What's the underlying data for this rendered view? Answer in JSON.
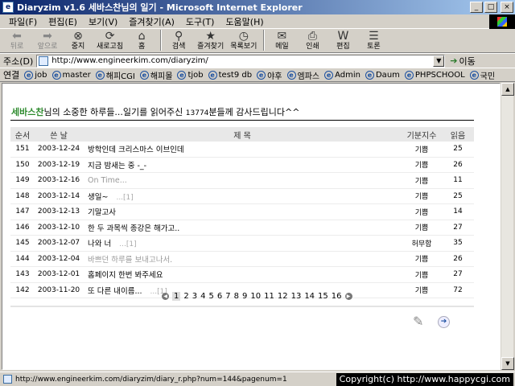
{
  "window": {
    "title": "Diaryzim v1.6 세바스찬님의 일기 - Microsoft Internet Explorer",
    "min_glyph": "_",
    "max_glyph": "□",
    "close_glyph": "×"
  },
  "menu": [
    "파일(F)",
    "편집(E)",
    "보기(V)",
    "즐겨찾기(A)",
    "도구(T)",
    "도움말(H)"
  ],
  "toolbar": {
    "back": "뒤로",
    "forward": "앞으로",
    "stop": "중지",
    "refresh": "새로고침",
    "home": "홈",
    "search": "검색",
    "favorites": "즐겨찾기",
    "history": "목록보기",
    "mail": "메일",
    "print": "인쇄",
    "edit": "편집",
    "discuss": "토론"
  },
  "address": {
    "label": "주소(D)",
    "url": "http://www.engineerkim.com/diaryzim/",
    "go": "이동"
  },
  "links": {
    "label": "연결",
    "items": [
      "job",
      "master",
      "해피CGI",
      "해피몰",
      "tjob",
      "test9 db",
      "야후",
      "엠파스",
      "Admin",
      "Daum",
      "PHPSCHOOL",
      "국민"
    ]
  },
  "greeting": {
    "user": "세바스찬",
    "text1": "님의 소중한 하루들...일기를 읽어주신 ",
    "count": "13774",
    "text2": "분들께 감사드립니다^^"
  },
  "list": {
    "headers": {
      "num": "순서",
      "date": "쓴 날",
      "title": "제 목",
      "mood": "기분지수",
      "read": "읽음"
    },
    "rows": [
      {
        "num": "151",
        "date": "2003-12-24",
        "title": "방학인데 크리스마스 이브인데",
        "comment": "",
        "mood": "기쁨",
        "read": "25",
        "faded": false
      },
      {
        "num": "150",
        "date": "2003-12-19",
        "title": "지금 밤새는 중 -_-",
        "comment": "",
        "mood": "기쁨",
        "read": "26",
        "faded": false
      },
      {
        "num": "149",
        "date": "2003-12-16",
        "title": "On Time...",
        "comment": "",
        "mood": "기쁨",
        "read": "11",
        "faded": true
      },
      {
        "num": "148",
        "date": "2003-12-14",
        "title": "생일~",
        "comment": "...[1]",
        "mood": "기쁨",
        "read": "25",
        "faded": false
      },
      {
        "num": "147",
        "date": "2003-12-13",
        "title": "기말고사",
        "comment": "",
        "mood": "기쁨",
        "read": "14",
        "faded": false
      },
      {
        "num": "146",
        "date": "2003-12-10",
        "title": "한 두 과목씩 종강은 해가고..",
        "comment": "",
        "mood": "기쁨",
        "read": "27",
        "faded": false
      },
      {
        "num": "145",
        "date": "2003-12-07",
        "title": "나와 너",
        "comment": "...[1]",
        "mood": "허무함",
        "read": "35",
        "faded": false
      },
      {
        "num": "144",
        "date": "2003-12-04",
        "title": "바쁘던 하루를 보내고나서.",
        "comment": "",
        "mood": "기쁨",
        "read": "26",
        "faded": true
      },
      {
        "num": "143",
        "date": "2003-12-01",
        "title": "홈페이지 한번 봐주세요",
        "comment": "",
        "mood": "기쁨",
        "read": "27",
        "faded": false
      },
      {
        "num": "142",
        "date": "2003-11-20",
        "title": "또 다른 내이름...",
        "comment": "...[1]",
        "mood": "기쁨",
        "read": "72",
        "faded": false
      }
    ]
  },
  "pager": {
    "prev_glyph": "◀",
    "next_glyph": "▶",
    "pages": [
      "1",
      "2",
      "3",
      "4",
      "5",
      "6",
      "7",
      "8",
      "9",
      "10",
      "11",
      "12",
      "13",
      "14",
      "15",
      "16"
    ],
    "current": "1"
  },
  "status": {
    "url": "http://www.engineerkim.com/diaryzim/diary_r.php?num=144&pagenum=1",
    "copyright": "Copyright(c) http://www.happycgi.com"
  },
  "colors": {
    "username": "#2e8b2e",
    "titlebar_start": "#0a246a",
    "titlebar_end": "#a6caf0"
  }
}
